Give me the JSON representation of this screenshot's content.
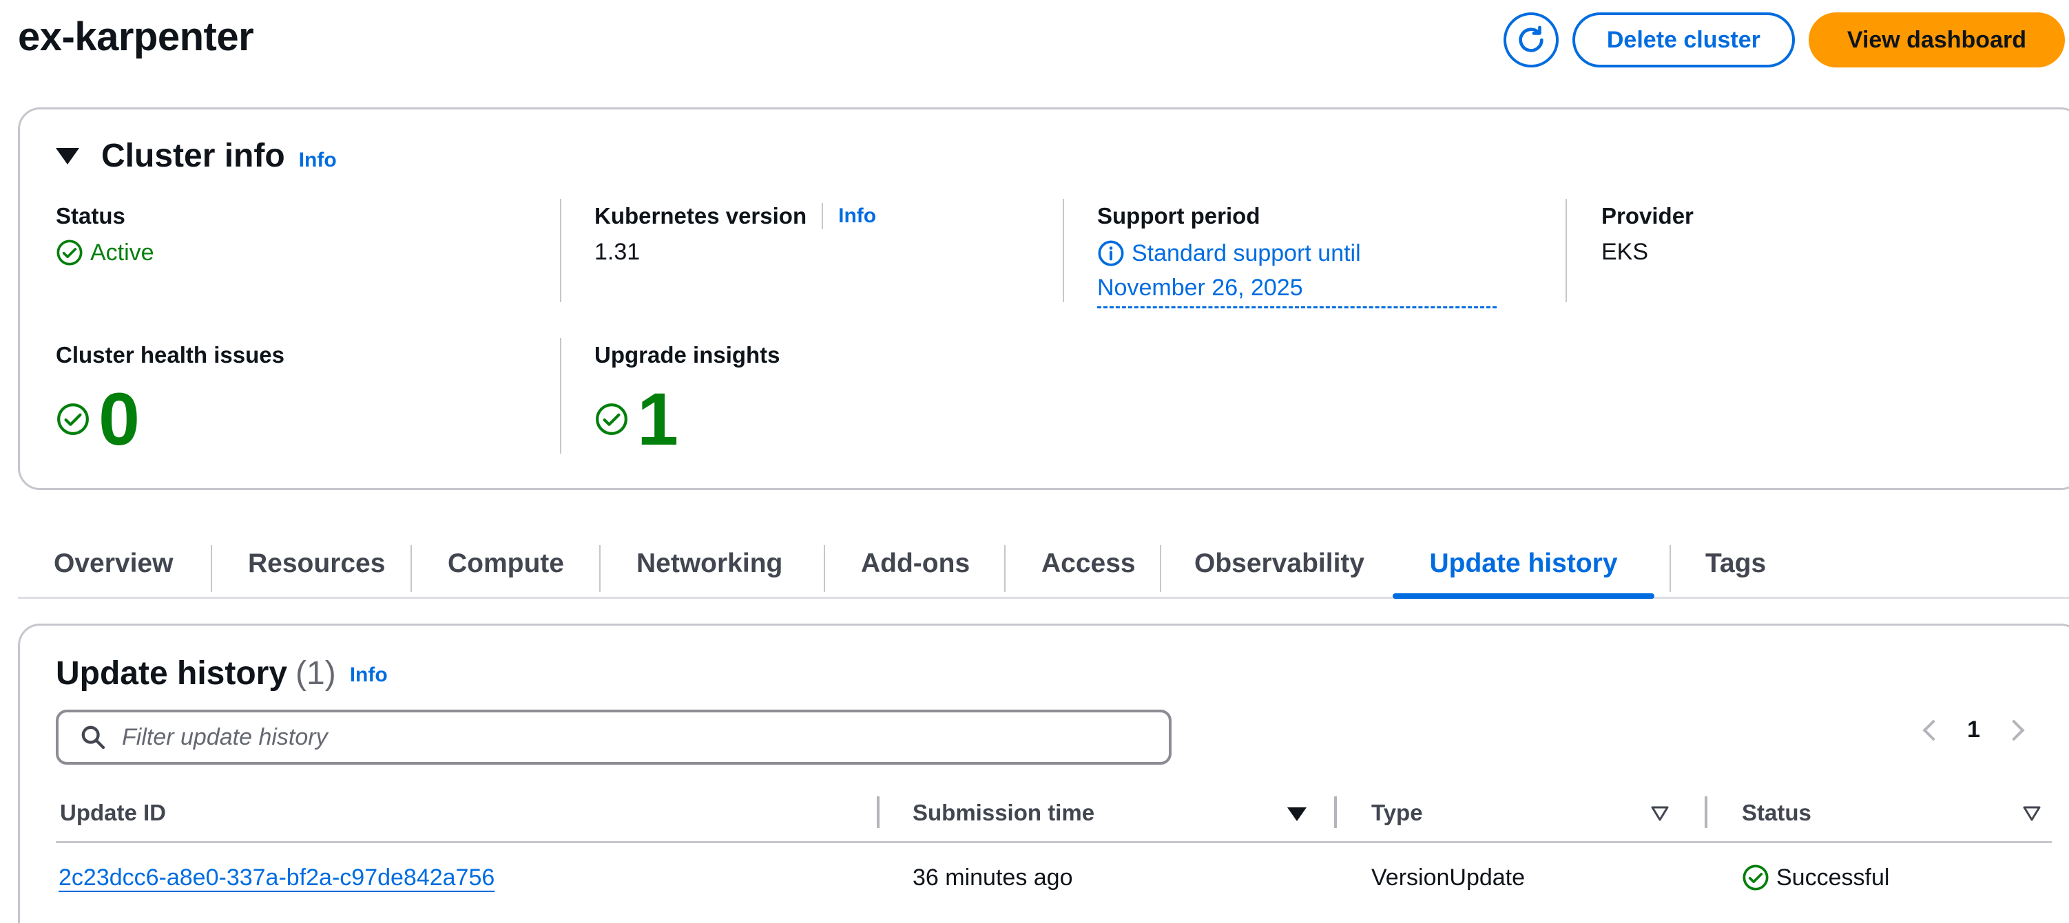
{
  "header": {
    "title": "ex-karpenter",
    "refresh_icon": "refresh-icon",
    "delete_label": "Delete cluster",
    "dashboard_label": "View dashboard"
  },
  "cluster_info": {
    "title": "Cluster info",
    "info_label": "Info",
    "status_label": "Status",
    "status_value": "Active",
    "k8s_label": "Kubernetes version",
    "k8s_info": "Info",
    "k8s_value": "1.31",
    "support_label": "Support period",
    "support_line1": "Standard support until",
    "support_line2": "November 26, 2025",
    "provider_label": "Provider",
    "provider_value": "EKS",
    "health_label": "Cluster health issues",
    "health_value": "0",
    "insights_label": "Upgrade insights",
    "insights_value": "1"
  },
  "tabs": [
    {
      "label": "Overview"
    },
    {
      "label": "Resources"
    },
    {
      "label": "Compute"
    },
    {
      "label": "Networking"
    },
    {
      "label": "Add-ons"
    },
    {
      "label": "Access"
    },
    {
      "label": "Observability"
    },
    {
      "label": "Update history",
      "active": true
    },
    {
      "label": "Tags"
    }
  ],
  "update_history": {
    "title": "Update history",
    "count": "(1)",
    "info_label": "Info",
    "search_placeholder": "Filter update history",
    "page": "1",
    "columns": [
      "Update ID",
      "Submission time",
      "Type",
      "Status"
    ],
    "rows": [
      {
        "id": "2c23dcc6-a8e0-337a-bf2a-c97de842a756",
        "time": "36 minutes ago",
        "type": "VersionUpdate",
        "status": "Successful"
      }
    ]
  },
  "colors": {
    "accent": "#006ce0",
    "primary_button": "#ff9900",
    "success": "#037f0c"
  }
}
